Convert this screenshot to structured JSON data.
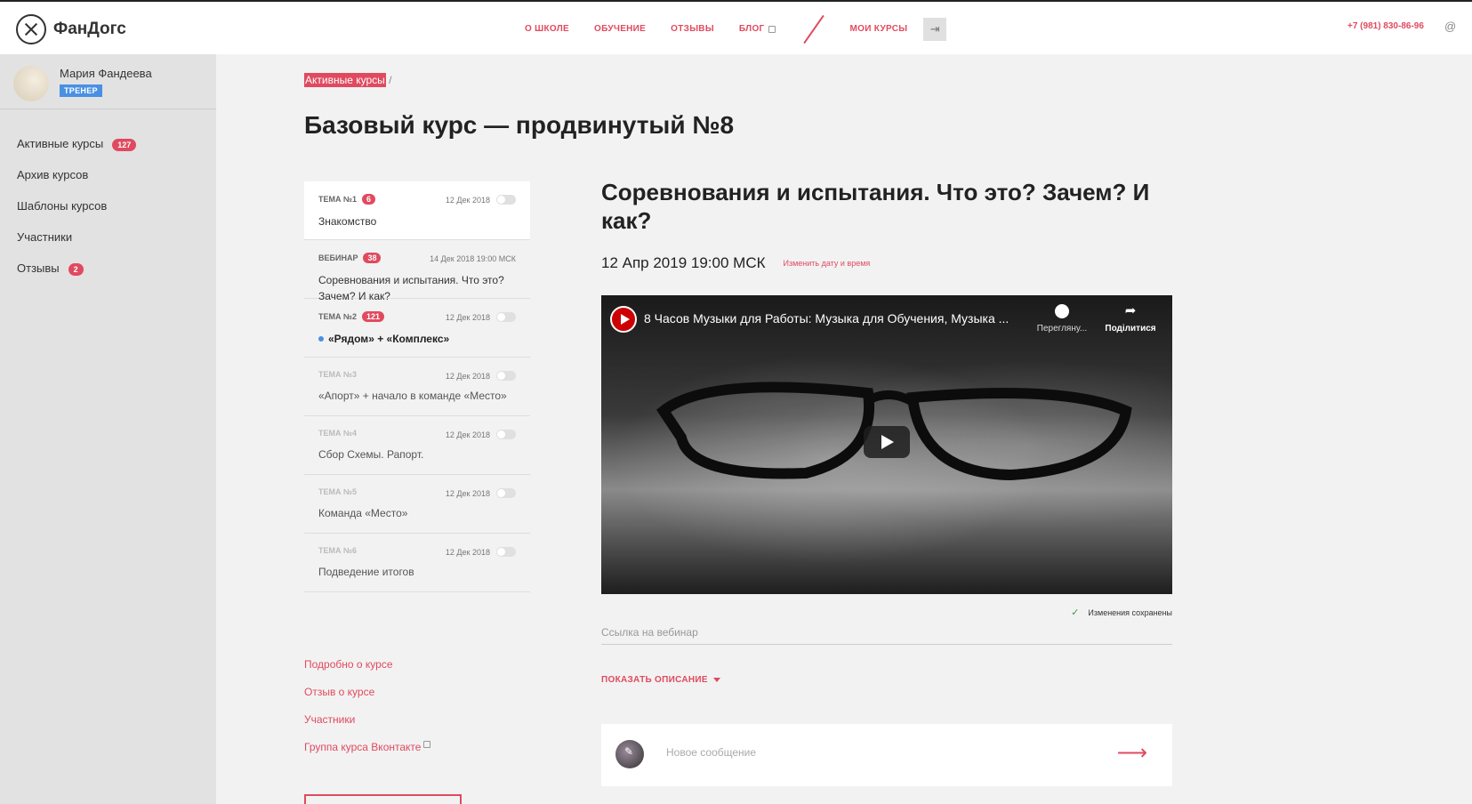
{
  "header": {
    "logo_text": "ФанДогс",
    "nav": [
      "О ШКОЛЕ",
      "ОБУЧЕНИЕ",
      "ОТЗЫВЫ",
      "БЛОГ"
    ],
    "my_courses": "МОИ КУРСЫ",
    "phone": "+7 (981) 830-86-96",
    "at_symbol": "@"
  },
  "sidebar": {
    "user_name": "Мария Фандеева",
    "role": "ТРЕНЕР",
    "items": [
      {
        "label": "Активные курсы",
        "count": "127"
      },
      {
        "label": "Архив курсов",
        "count": ""
      },
      {
        "label": "Шаблоны курсов",
        "count": ""
      },
      {
        "label": "Участники",
        "count": ""
      },
      {
        "label": "Отзывы",
        "count": "2"
      }
    ]
  },
  "breadcrumb": {
    "link": "Активные курсы",
    "sep": "/"
  },
  "page_title": "Базовый курс — продвинутый №8",
  "topics": [
    {
      "tag": "ТЕМА №1",
      "count": "6",
      "date": "12 Дек 2018",
      "title": "Знакомство"
    },
    {
      "tag": "ВЕБИНАР",
      "count": "38",
      "date": "14 Дек 2018 19:00 МСК",
      "title": "Соревнования и испытания. Что это? Зачем? И как?"
    },
    {
      "tag": "ТЕМА №2",
      "count": "121",
      "date": "12 Дек 2018",
      "title": "«Рядом» + «Комплекс»"
    },
    {
      "tag": "ТЕМА №3",
      "count": "",
      "date": "12 Дек 2018",
      "title": "«Апорт» + начало в команде «Место»"
    },
    {
      "tag": "ТЕМА №4",
      "count": "",
      "date": "12 Дек 2018",
      "title": "Сбор Схемы. Рапорт."
    },
    {
      "tag": "ТЕМА №5",
      "count": "",
      "date": "12 Дек 2018",
      "title": "Команда «Место»"
    },
    {
      "tag": "ТЕМА №6",
      "count": "",
      "date": "12 Дек 2018",
      "title": "Подведение итогов"
    }
  ],
  "course_links": [
    "Подробно о курсе",
    "Отзыв о курсе",
    "Участники",
    "Группа курса Вконтакте"
  ],
  "lesson": {
    "title": "Соревнования и испытания. Что это? Зачем? И как?",
    "date": "12 Апр 2019 19:00 МСК",
    "change_date": "Изменить дату и время",
    "video_title": "8 Часов Музыки для Работы: Музыка для Обучения, Музыка ...",
    "watch_later": "Перегляну...",
    "share": "Поділитися",
    "saved": "Изменения сохранены",
    "link_placeholder": "Ссылка на вебинар",
    "show_description": "ПОКАЗАТЬ ОПИСАНИЕ",
    "message_placeholder": "Новое сообщение"
  },
  "colors": {
    "accent": "#e04a5f",
    "badge_blue": "#4a90e2",
    "sidebar_bg": "#e2e2e2"
  }
}
